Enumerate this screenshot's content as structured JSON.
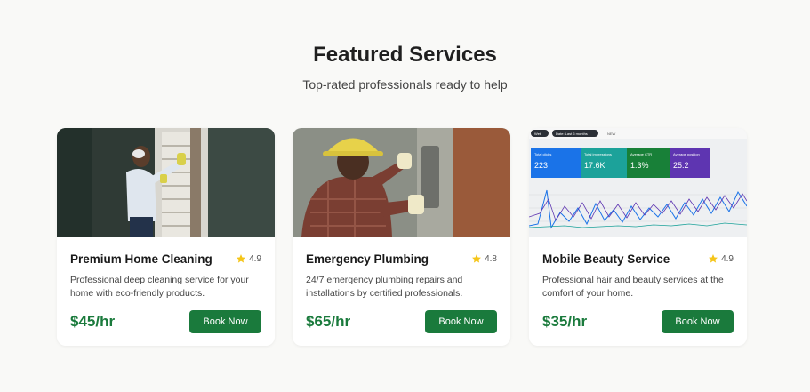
{
  "header": {
    "title": "Featured Services",
    "subtitle": "Top-rated professionals ready to help"
  },
  "cards": [
    {
      "image_icon": "cleaning-photo",
      "title": "Premium Home Cleaning",
      "rating": "4.9",
      "description": "Professional deep cleaning service for your home with eco-friendly products.",
      "price": "$45/hr",
      "button_label": "Book Now"
    },
    {
      "image_icon": "plumbing-photo",
      "title": "Emergency Plumbing",
      "rating": "4.8",
      "description": "24/7 emergency plumbing repairs and installations by certified professionals.",
      "price": "$65/hr",
      "button_label": "Book Now"
    },
    {
      "image_icon": "analytics-dashboard-photo",
      "title": "Mobile Beauty Service",
      "rating": "4.9",
      "description": "Professional hair and beauty services at the comfort of your home.",
      "price": "$35/hr",
      "button_label": "Book Now",
      "dashboard": {
        "tabs": [
          "Web",
          "Date: Last 6 months",
          "NEW"
        ],
        "metrics": [
          {
            "label": "Total clicks",
            "value": "223"
          },
          {
            "label": "Total impressions",
            "value": "17.6K"
          },
          {
            "label": "Average CTR",
            "value": "1.3%"
          },
          {
            "label": "Average position",
            "value": "25.2"
          }
        ]
      }
    }
  ],
  "colors": {
    "accent": "#1a7a3c",
    "star": "#f5c518",
    "background": "#f9f9f7"
  }
}
